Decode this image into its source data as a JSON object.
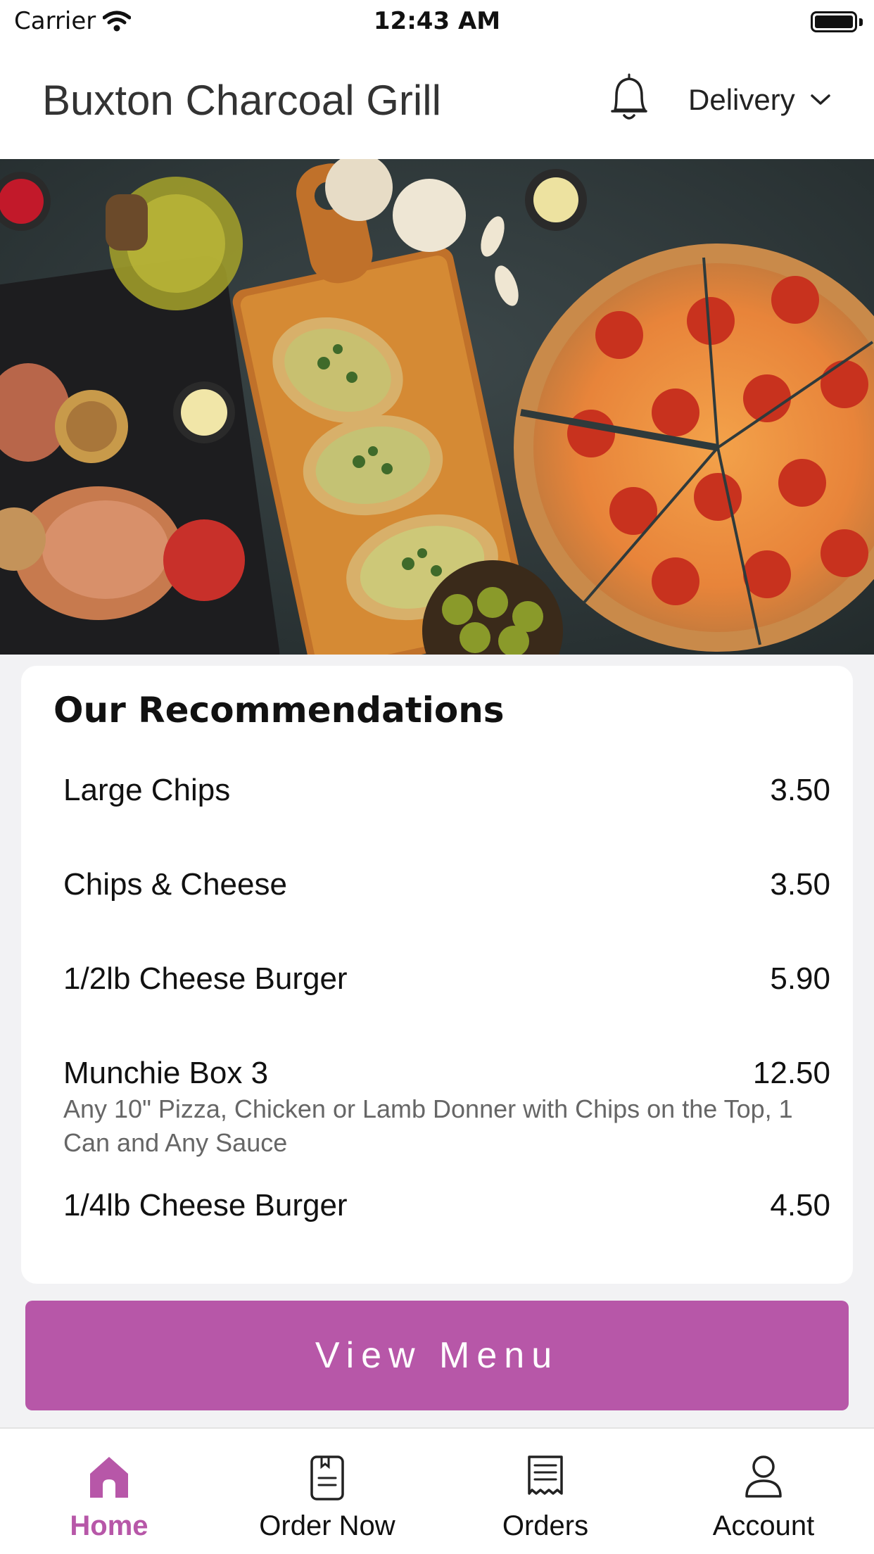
{
  "status_bar": {
    "carrier": "Carrier",
    "time": "12:43 AM"
  },
  "header": {
    "title": "Buxton Charcoal Grill",
    "delivery_label": "Delivery"
  },
  "recommendations": {
    "title": "Our Recommendations",
    "items": [
      {
        "name": "Large Chips",
        "price": "3.50",
        "description": ""
      },
      {
        "name": "Chips & Cheese",
        "price": "3.50",
        "description": ""
      },
      {
        "name": "1/2lb Cheese Burger",
        "price": "5.90",
        "description": ""
      },
      {
        "name": "Munchie Box 3",
        "price": "12.50",
        "description": "Any 10\" Pizza, Chicken or Lamb Donner with Chips on the Top, 1 Can and Any Sauce"
      },
      {
        "name": "1/4lb Cheese Burger",
        "price": "4.50",
        "description": ""
      }
    ]
  },
  "view_menu_label": "View Menu",
  "tabs": [
    {
      "label": "Home",
      "icon": "home-icon",
      "active": true
    },
    {
      "label": "Order Now",
      "icon": "menu-book-icon",
      "active": false
    },
    {
      "label": "Orders",
      "icon": "receipt-icon",
      "active": false
    },
    {
      "label": "Account",
      "icon": "user-icon",
      "active": false
    }
  ],
  "colors": {
    "accent": "#b757a8",
    "text": "#111111",
    "muted": "#666666"
  }
}
